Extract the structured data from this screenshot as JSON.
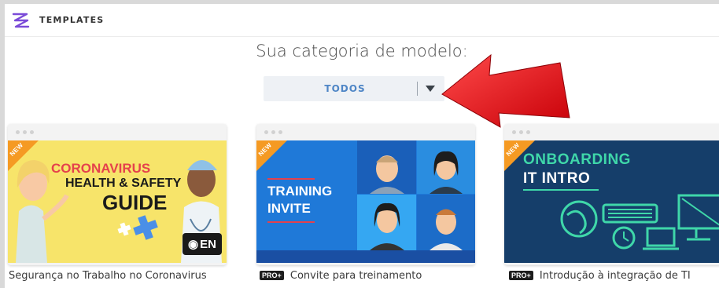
{
  "header": {
    "brand": "TEMPLATES",
    "logo_icon": "templates-logo-icon"
  },
  "main": {
    "heading": "Sua categoria de modelo:",
    "category_dropdown": {
      "selected": "TODOS",
      "caret_icon": "caret-down-icon"
    }
  },
  "annotation": {
    "arrow_icon": "red-arrow-icon",
    "arrow_color": "#e8141b"
  },
  "templates": [
    {
      "badge": "NEW",
      "thumbnail_lines": [
        "CORONAVIRUS",
        "HEALTH & SAFETY",
        "GUIDE"
      ],
      "language_badge": "EN",
      "caption": "Segurança no Trabalho no Coronavirus",
      "pro": ""
    },
    {
      "badge": "NEW",
      "thumbnail_lines": [
        "TRAINING",
        "INVITE"
      ],
      "caption": "Convite para treinamento",
      "pro": "PRO+"
    },
    {
      "badge": "NEW",
      "thumbnail_lines": [
        "ONBOARDING",
        "IT INTRO"
      ],
      "caption": "Introdução à integração de TI",
      "pro": "PRO+"
    }
  ],
  "colors": {
    "accent_blue": "#4f86c6",
    "new_badge": "#f59a23",
    "arrow_red": "#e8141b"
  }
}
